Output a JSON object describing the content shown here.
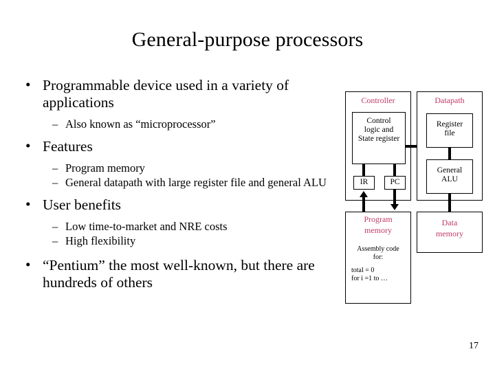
{
  "slide": {
    "title": "General-purpose processors",
    "page_number": "17"
  },
  "bullets": {
    "b1": "Programmable device used in a variety of applications",
    "b1s1": "Also known as “microprocessor”",
    "b2": "Features",
    "b2s1": "Program memory",
    "b2s2": "General datapath with large register file and general ALU",
    "b3": "User benefits",
    "b3s1": "Low time-to-market and NRE costs",
    "b3s2": "High flexibility",
    "b4": "“Pentium” the most well-known, but there are hundreds of others",
    "marker_level1": "•",
    "marker_level2": "–"
  },
  "diagram": {
    "controller_title": "Controller",
    "control_logic": "Control\nlogic and\nState register",
    "control_logic_line1": "Control",
    "control_logic_line2": "logic and",
    "control_logic_line3": "State register",
    "ir": "IR",
    "pc": "PC",
    "datapath_title": "Datapath",
    "register_file_line1": "Register",
    "register_file_line2": "file",
    "general_alu_line1": "General",
    "general_alu_line2": "ALU",
    "program_memory_line1": "Program",
    "program_memory_line2": "memory",
    "assembly_caption_line1": "Assembly code",
    "assembly_caption_line2": "for:",
    "assembly_code_line1": "total = 0",
    "assembly_code_line2": "for i =1 to …",
    "data_memory_line1": "Data",
    "data_memory_line2": "memory"
  },
  "colors": {
    "label_pink": "#C03A66",
    "text_black": "#000000",
    "background": "#FFFFFF",
    "stroke": "#000000"
  }
}
